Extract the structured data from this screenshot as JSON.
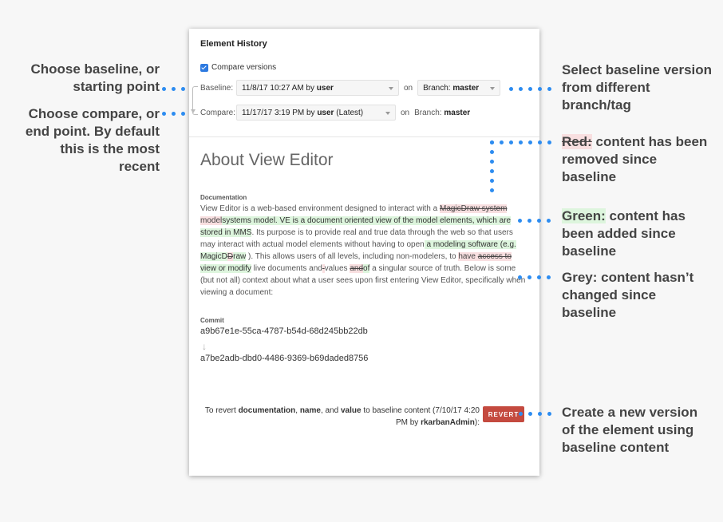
{
  "panel": {
    "title": "Element History",
    "compare_label": "Compare versions",
    "baseline": {
      "label": "Baseline:",
      "version_date": "11/8/17 10:27 AM by",
      "version_user": "user",
      "on": "on",
      "branch_prefix": "Branch:",
      "branch": "master"
    },
    "compare": {
      "label": "Compare:",
      "version_date": "11/17/17 3:19 PM by",
      "version_user": "user",
      "version_suffix": "(Latest)",
      "on": "on",
      "branch_prefix": "Branch:",
      "branch": "master"
    },
    "doc_title": "About View Editor",
    "documentation_label": "Documentation",
    "documentation": {
      "s1": "View Editor is a web-based environment designed to interact with a ",
      "d1": "MagicDraw system",
      "s2": " ",
      "r1": "model",
      "a1": "systems model. VE is a document oriented view of the model elements, which are stored in MMS",
      "s3": ". Its purpose is to provide real and true data through the web so that users may interact with actual model elements without having to open",
      "a2": " a modeling software (e.g. MagicD",
      "d2": "D",
      "a3": "raw",
      "s4": " ). This allows users of all levels, including non-modelers, to ",
      "r2": "have ",
      "d3": "access to",
      "a4": " view or modify",
      "s5": " live documents and",
      "d4": " ",
      "s6": " values ",
      "d5": "and",
      "a5": "of",
      "s7": " a singular source of truth. Below is some (but not all) context about what a user sees upon first entering View Editor, specifically when viewing a document:"
    },
    "commit_label": "Commit",
    "commit_from": "a9b67e1e-55ca-4787-b54d-68d245bb22db",
    "commit_to": "a7be2adb-dbd0-4486-9369-b69daded8756",
    "revert": {
      "t1": "To revert ",
      "b1": "documentation",
      "t2": ", ",
      "b2": "name",
      "t3": ", and ",
      "b3": "value",
      "t4": " to baseline content (7/10/17 4:20 PM by ",
      "b4": "rkarbanAdmin",
      "t5": "):",
      "button": "REVERT"
    }
  },
  "annotations": {
    "baseline": "Choose baseline, or starting point",
    "compare": "Choose compare, or end point. By default this is the most recent",
    "select_baseline": "Select baseline version from different branch/tag",
    "red_word": "Red:",
    "red_text": " content has been removed since baseline",
    "green_word": "Green:",
    "green_text": " content has been added since baseline",
    "grey_word": "Grey:",
    "grey_text": " content hasn’t changed since baseline",
    "revert": "Create a new version of the element using baseline content"
  },
  "colors": {
    "accent": "#2d8cf0",
    "removed": "#f8dfe0",
    "added": "#ddf5dd",
    "revert_button": "#c44a3f"
  }
}
